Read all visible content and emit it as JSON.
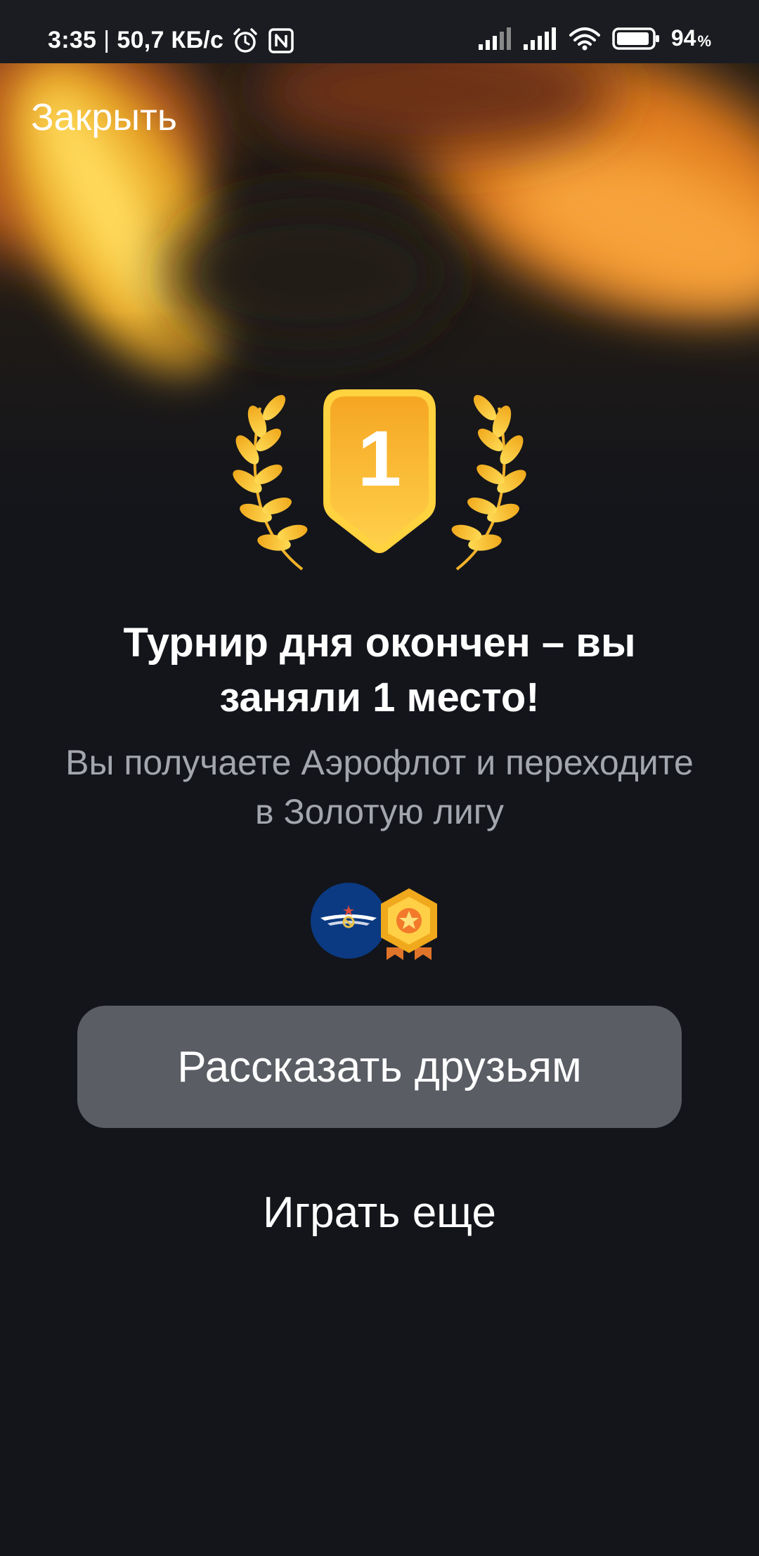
{
  "status_bar": {
    "time": "3:35",
    "separator": "|",
    "speed": "50,7 КБ/с",
    "battery_percent": "94",
    "battery_unit": "%",
    "battery_level": 0.94,
    "icons": [
      "alarm-icon",
      "nfc-icon",
      "signal-icon",
      "wifi-icon",
      "battery-icon"
    ]
  },
  "header": {
    "close_label": "Закрыть"
  },
  "result": {
    "place": "1",
    "title": "Турнир дня окончен – вы заняли 1 место!",
    "subtitle": "Вы получаете Аэрофлот и переходите в Золотую лигу",
    "rewards": [
      "aeroflot-logo-icon",
      "gold-league-badge-icon"
    ]
  },
  "actions": {
    "share_label": "Рассказать друзьям",
    "play_again_label": "Играть еще"
  },
  "colors": {
    "background": "#13151b",
    "accent_gold": "#f6b81c",
    "button_bg": "#5a5d64",
    "subtitle_text": "#a3a6ad",
    "aeroflot_blue": "#0b3a82"
  }
}
